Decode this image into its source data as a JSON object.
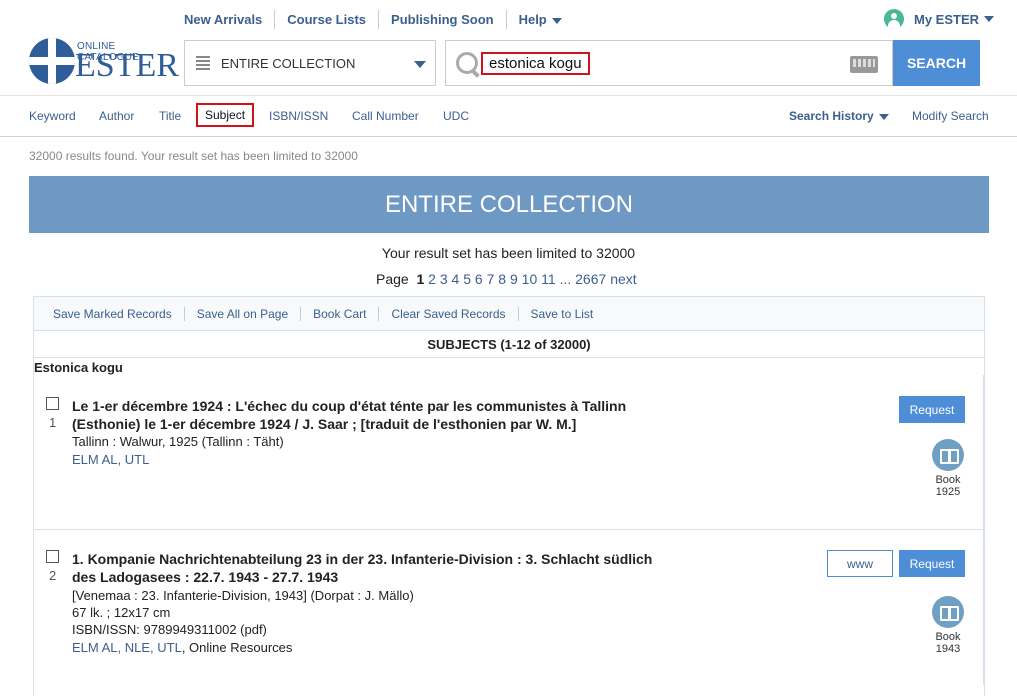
{
  "topnav": {
    "items": [
      "New Arrivals",
      "Course Lists",
      "Publishing Soon",
      "Help"
    ],
    "my_ester": "My ESTER"
  },
  "logo": {
    "small": "ONLINE CATALOGUE",
    "big": "ESTER"
  },
  "scope": {
    "selected": "ENTIRE COLLECTION"
  },
  "search": {
    "value": "estonica kogu",
    "button": "SEARCH"
  },
  "tabs": {
    "items": [
      "Keyword",
      "Author",
      "Title",
      "Subject",
      "ISBN/ISSN",
      "Call Number",
      "UDC"
    ],
    "active": "Subject",
    "history": "Search History",
    "modify": "Modify Search"
  },
  "results": {
    "notice": "32000 results found. Your result set has been limited to 32000",
    "banner": "ENTIRE COLLECTION",
    "limited": "Your result set has been limited to 32000",
    "page_label": "Page",
    "current_page": "1",
    "pages": [
      "2",
      "3",
      "4",
      "5",
      "6",
      "7",
      "8",
      "9",
      "10",
      "11",
      "...",
      "2667",
      "next"
    ]
  },
  "actions": [
    "Save Marked Records",
    "Save All on Page",
    "Book Cart",
    "Clear Saved Records",
    "Save to List"
  ],
  "subjects_header": "SUBJECTS (1-12 of 32000)",
  "group_title": "Estonica kogu",
  "records": [
    {
      "num": "1",
      "title_line1": "Le 1-er décembre 1924 : L'échec du coup d'état ténte par les communistes à Tallinn",
      "title_line2": "(Esthonie) le 1-er décembre 1924 / J. Saar ; [traduit de l'esthonien par W. M.]",
      "pub": "Tallinn : Walwur, 1925 (Tallinn : Täht)",
      "links": "ELM AL, UTL",
      "request": "Request",
      "type": "Book",
      "year": "1925"
    },
    {
      "num": "2",
      "title_line1": "1. Kompanie Nachrichtenabteilung 23 in der 23. Infanterie-Division : 3. Schlacht südlich",
      "title_line2": "des Ladogasees : 22.7. 1943 - 27.7. 1943",
      "pub": "[Venemaa : 23. Infanterie-Division, 1943] (Dorpat : J. Mällo)",
      "extent": "67 lk. ; 12x17 cm",
      "isbn": "ISBN/ISSN:  9789949311002 (pdf)",
      "links": "ELM AL, NLE, UTL",
      "links_tail": ", Online Resources",
      "www": "www",
      "request": "Request",
      "type": "Book",
      "year": "1943"
    }
  ]
}
